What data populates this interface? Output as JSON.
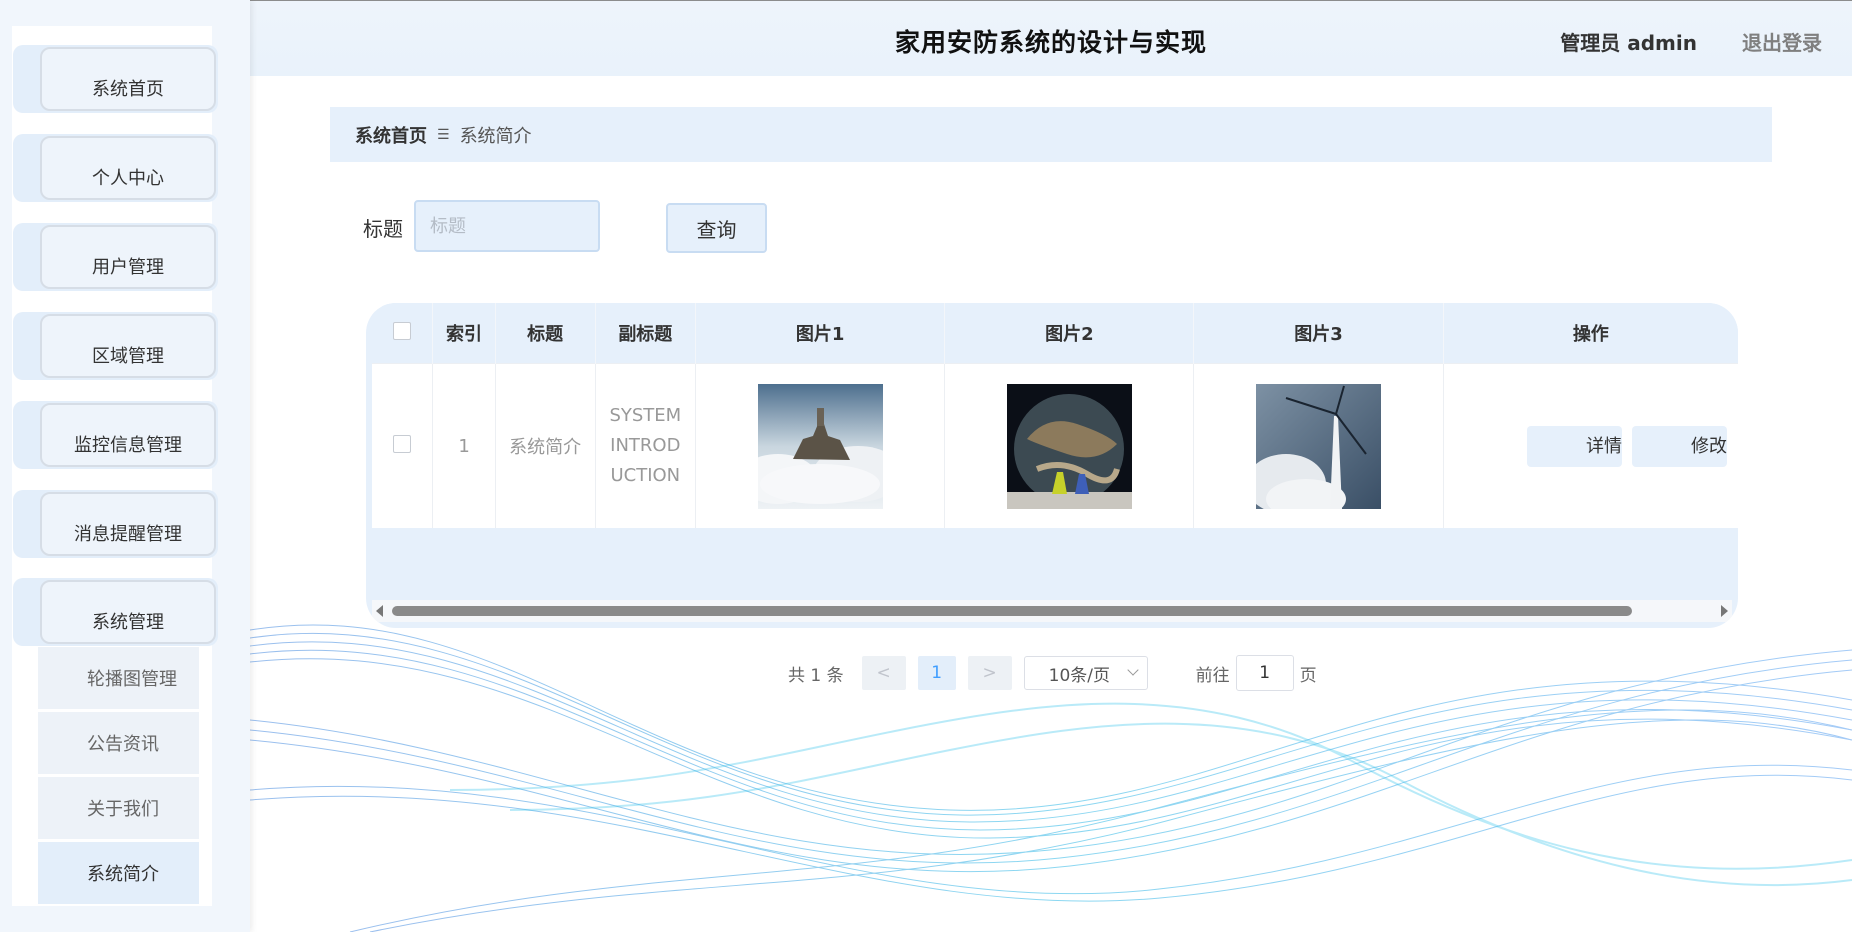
{
  "header": {
    "title": "家用安防系统的设计与实现",
    "user": "管理员 admin",
    "logout": "退出登录"
  },
  "sidebar": {
    "items": [
      {
        "label": "系统首页"
      },
      {
        "label": "个人中心"
      },
      {
        "label": "用户管理"
      },
      {
        "label": "区域管理"
      },
      {
        "label": "监控信息管理"
      },
      {
        "label": "消息提醒管理"
      },
      {
        "label": "系统管理"
      }
    ],
    "subitems": [
      {
        "label": "轮播图管理"
      },
      {
        "label": "公告资讯"
      },
      {
        "label": "关于我们"
      },
      {
        "label": "系统简介"
      }
    ]
  },
  "breadcrumb": {
    "home": "系统首页",
    "current": "系统简介"
  },
  "search": {
    "label": "标题",
    "placeholder": "标题",
    "value": "",
    "button": "查询"
  },
  "table": {
    "headers": {
      "index": "索引",
      "title": "标题",
      "subtitle": "副标题",
      "image1": "图片1",
      "image2": "图片2",
      "image3": "图片3",
      "actions": "操作"
    },
    "rows": [
      {
        "index": "1",
        "title": "系统简介",
        "subtitle_lines": [
          "SYSTEM",
          "INTROD",
          "UCTION"
        ],
        "detail": "详情",
        "edit": "修改"
      }
    ]
  },
  "pagination": {
    "total": "共 1 条",
    "prev": "<",
    "page": "1",
    "next": ">",
    "page_size": "10条/页",
    "goto_prefix": "前往",
    "goto_value": "1",
    "goto_suffix": "页"
  }
}
